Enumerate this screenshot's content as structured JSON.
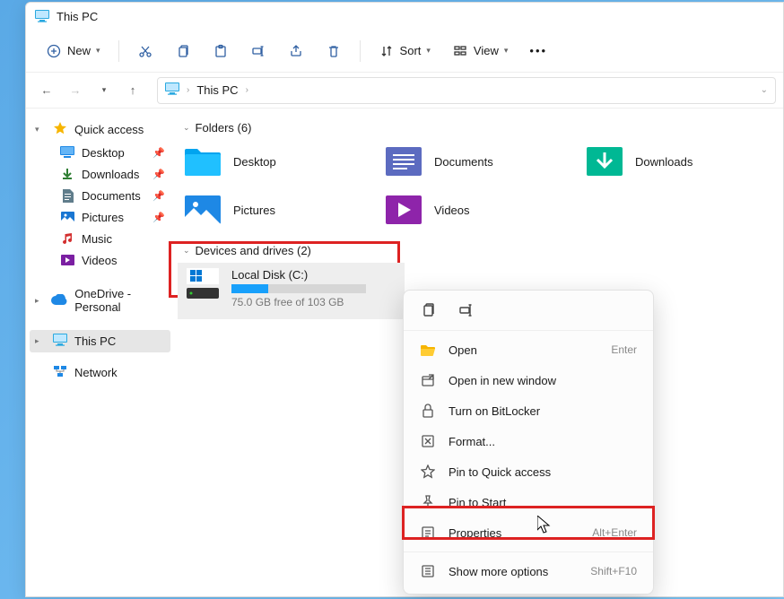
{
  "titlebar": {
    "title": "This PC"
  },
  "toolbar": {
    "new": "New",
    "sort": "Sort",
    "view": "View"
  },
  "address": {
    "path": "This PC"
  },
  "sidebar": {
    "quick": "Quick access",
    "desktop": "Desktop",
    "downloads": "Downloads",
    "documents": "Documents",
    "pictures": "Pictures",
    "music": "Music",
    "videos": "Videos",
    "onedrive": "OneDrive - Personal",
    "thispc": "This PC",
    "network": "Network"
  },
  "sections": {
    "folders": "Folders (6)",
    "drives": "Devices and drives (2)"
  },
  "folders": {
    "desktop": "Desktop",
    "documents": "Documents",
    "downloads": "Downloads",
    "pictures": "Pictures",
    "videos": "Videos"
  },
  "drive": {
    "name": "Local Disk (C:)",
    "hint": "75.0 GB free of 103 GB",
    "fill_percent": 27
  },
  "context": {
    "open": "Open",
    "open_shortcut": "Enter",
    "new_window": "Open in new window",
    "bitlocker": "Turn on BitLocker",
    "format": "Format...",
    "quick": "Pin to Quick access",
    "start": "Pin to Start",
    "properties": "Properties",
    "properties_shortcut": "Alt+Enter",
    "more": "Show more options",
    "more_shortcut": "Shift+F10"
  }
}
